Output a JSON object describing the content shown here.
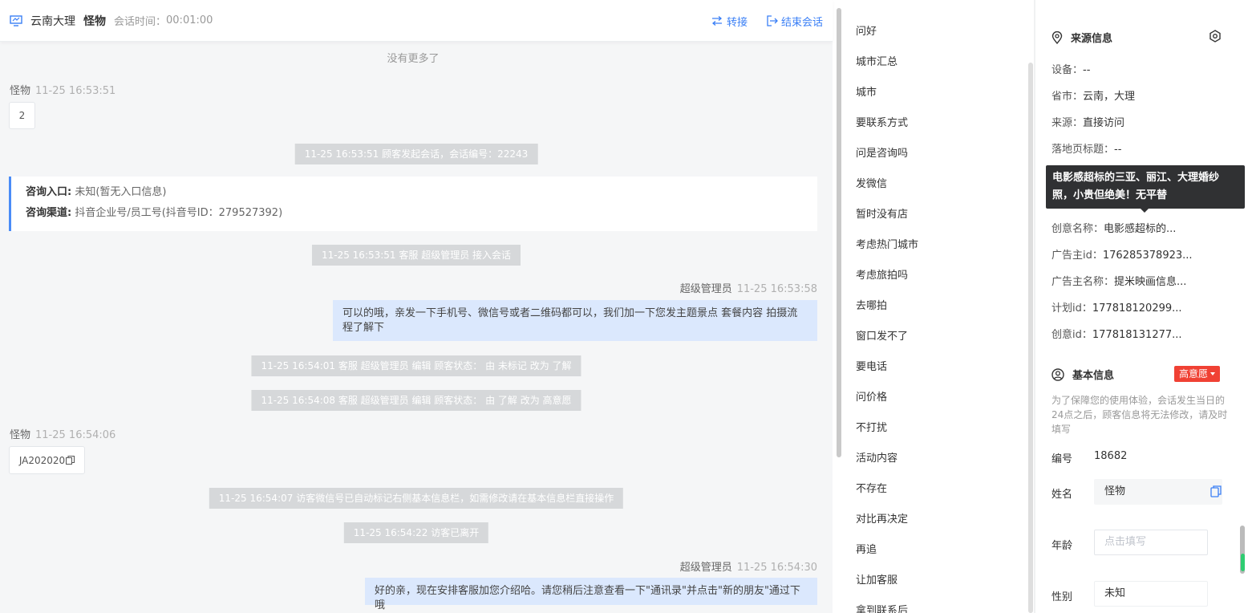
{
  "header": {
    "city": "云南大理",
    "name": "怪物",
    "time_label": "会话时间：",
    "time": "00:01:00",
    "transfer": "转接",
    "end": "结束会话"
  },
  "chat": {
    "no_more": "没有更多了",
    "m1": {
      "sender": "怪物",
      "time": "11-25 16:53:51",
      "text": "2"
    },
    "sys1": "11-25 16:53:51 顾客发起会话，会话编号：22243",
    "card": {
      "entry_label": "咨询入口:",
      "entry": "未知(暂无入口信息)",
      "channel_label": "咨询渠道:",
      "channel": "抖音企业号/员工号(抖音号ID：279527392)"
    },
    "sys2": "11-25 16:53:51 客服 超级管理员 接入会话",
    "m2": {
      "sender": "超级管理员",
      "time": "11-25 16:53:58",
      "text": "可以的哦，亲发一下手机号、微信号或者二维码都可以，我们加一下您发主题景点 套餐内容 拍摄流程了解下"
    },
    "sys3": "11-25 16:54:01 客服 超级管理员 编辑 顾客状态： 由 未标记 改为 了解",
    "sys4": "11-25 16:54:08 客服 超级管理员 编辑 顾客状态： 由 了解 改为 高意愿",
    "m3": {
      "sender": "怪物",
      "time": "11-25 16:54:06",
      "text": "JA202020"
    },
    "sys5": "11-25 16:54:07 访客微信号已自动标记右侧基本信息栏，如需修改请在基本信息栏直接操作",
    "sys6": "11-25 16:54:22 访客已离开",
    "m4": {
      "sender": "超级管理员",
      "time": "11-25 16:54:30",
      "text": "好的亲，现在安排客服加您介绍哈。请您稍后注意查看一下\"通讯录\"并点击\"新的朋友\"通过下哦"
    }
  },
  "quick_replies": [
    "问好",
    "城市汇总",
    "城市",
    "要联系方式",
    "问是咨询吗",
    "发微信",
    "暂时没有店",
    "考虑热门城市",
    "考虑旅拍吗",
    "去哪拍",
    "窗口发不了",
    "要电话",
    "问价格",
    "不打扰",
    "活动内容",
    "不存在",
    "对比再决定",
    "再追",
    "让加客服",
    "拿到联系后"
  ],
  "source": {
    "title": "来源信息",
    "device_label": "设备：",
    "device": "--",
    "province_label": "省市：",
    "province": "云南，大理",
    "from_label": "来源：",
    "from": "直接访问",
    "landing_label": "落地页标题：",
    "landing": "--",
    "tooltip": "电影感超标的三亚、丽江、大理婚纱照，小贵但绝美！无平替",
    "creative_name_label": "创意名称：",
    "creative_name": "电影感超标的...",
    "advertiser_id_label": "广告主id：",
    "advertiser_id": "176285378923...",
    "advertiser_name_label": "广告主名称：",
    "advertiser_name": "提米映画信息...",
    "plan_id_label": "计划id：",
    "plan_id": "177818120299...",
    "creative_id_label": "创意id：",
    "creative_id": "177818131277..."
  },
  "basic": {
    "title": "基本信息",
    "badge": "高意愿",
    "hint": "为了保障您的使用体验，会话发生当日的24点之后，顾客信息将无法修改，请及时填写",
    "no_label": "编号",
    "no": "18682",
    "name_label": "姓名",
    "name": "怪物",
    "age_label": "年龄",
    "age_placeholder": "点击填写",
    "gender_label": "性别",
    "gender": "未知"
  },
  "colors": {
    "accent": "#3a7ff6",
    "badge": "#f04134",
    "bubble": "#dbe8fd"
  }
}
